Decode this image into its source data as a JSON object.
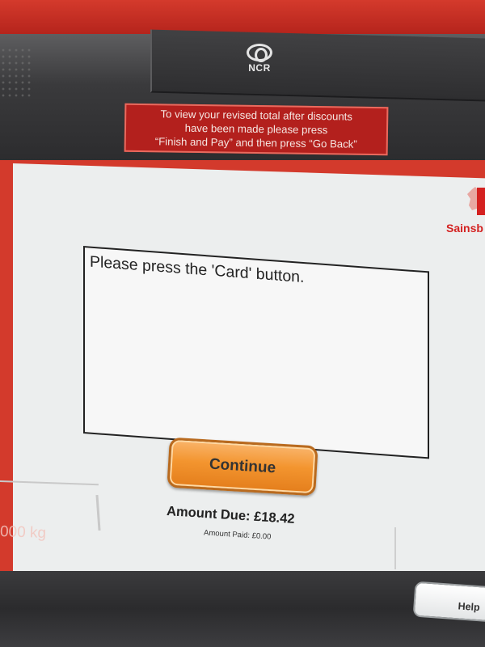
{
  "device": {
    "brand": "NCR",
    "notice_lines": [
      "To view your revised total after discounts",
      "have been made please press",
      "“Finish and Pay” and then press “Go Back”"
    ]
  },
  "store": {
    "name": "Sainsb"
  },
  "dialog": {
    "message": "Please press the 'Card' button.",
    "continue_label": "Continue"
  },
  "footer": {
    "amount_due": "Amount Due: £18.42",
    "amount_paid": "Amount Paid: £0.00",
    "weight": "000 kg",
    "help_label": "Help"
  },
  "colors": {
    "kiosk_red": "#c8201a",
    "button_orange": "#f3952f",
    "brand_red": "#d42120"
  }
}
